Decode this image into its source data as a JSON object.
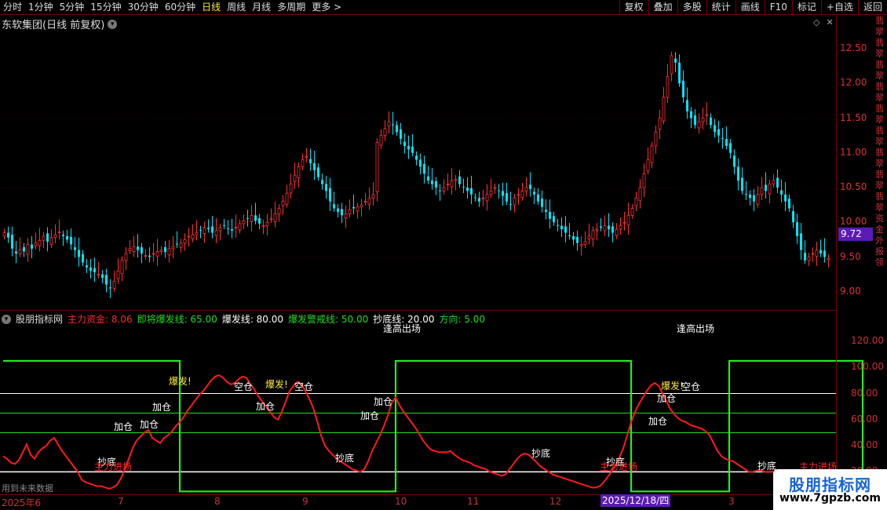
{
  "toolbar": {
    "periods": [
      "分时",
      "1分钟",
      "5分钟",
      "15分钟",
      "30分钟",
      "60分钟",
      "日线",
      "周线",
      "月线",
      "多周期",
      "更多"
    ],
    "active_period": "日线",
    "more_arrow": ">",
    "tools": [
      "复权",
      "叠加",
      "多股",
      "统计",
      "画线",
      "F10",
      "标记",
      "+自选",
      "返回"
    ]
  },
  "main_chart": {
    "title": "东软集团(日线 前复权)",
    "current_price": "9.72",
    "price_axis": [
      "12.50",
      "12.00",
      "11.50",
      "11.00",
      "10.50",
      "10.00",
      "9.50",
      "9.00"
    ],
    "side_text": "翡翠翡翠翡翠翡翠翡翠翡翠翡翠翡翠翡翠资金外报领"
  },
  "indicator": {
    "name": "股朋指标网",
    "params": [
      {
        "label": "主力资金:",
        "value": "8.06",
        "color": "#ff2a2a"
      },
      {
        "label": "即将爆发线:",
        "value": "65.00",
        "color": "#22dd22"
      },
      {
        "label": "爆发线:",
        "value": "80.00",
        "color": "#ffffff"
      },
      {
        "label": "爆发警戒线:",
        "value": "50.00",
        "color": "#22dd22"
      },
      {
        "label": "抄底线:",
        "value": "20.00",
        "color": "#ffffff"
      },
      {
        "label": "方向:",
        "value": "5.00",
        "color": "#22dd22"
      }
    ],
    "axis": [
      "120.00",
      "100.00",
      "80.00",
      "60.00",
      "40.00",
      "20.00"
    ],
    "signals": {
      "chaodi": "抄底",
      "jiacang": "加仓",
      "kongcang": "空仓",
      "baofa": "爆发!",
      "zhulijinchang": "主力进场",
      "tiaogao": "逢高出场"
    },
    "future_note": "用到未来数据",
    "side_text": "翡翠翡翠翡翠翡翠"
  },
  "date_axis": {
    "labels": [
      "2025年6",
      "7",
      "8",
      "9",
      "10",
      "11",
      "12",
      "2",
      "3"
    ],
    "cursor_date": "2025/12/18/四"
  },
  "watermark": {
    "title": "股朋指标网",
    "url": "www.7gpzb.com"
  },
  "colors": {
    "up": "#ff3232",
    "down": "#00e5ff",
    "main_line": "#ff1a1a",
    "direction_line": "#22ee22",
    "frame": "#7a0000",
    "label_red": "#d33333",
    "cursor": "#5b1bb5"
  },
  "chart_data": [
    {
      "type": "candlestick",
      "title": "东软集团(日线 前复权)",
      "ylim": [
        8.85,
        12.75
      ],
      "close": [
        9.85,
        9.78,
        9.62,
        9.55,
        9.6,
        9.58,
        9.68,
        9.62,
        9.7,
        9.74,
        9.8,
        9.72,
        9.78,
        9.82,
        9.86,
        9.8,
        9.75,
        9.68,
        9.6,
        9.5,
        9.42,
        9.35,
        9.3,
        9.28,
        9.25,
        9.2,
        9.1,
        9.05,
        9.15,
        9.3,
        9.45,
        9.55,
        9.62,
        9.65,
        9.6,
        9.55,
        9.52,
        9.5,
        9.55,
        9.58,
        9.6,
        9.57,
        9.62,
        9.65,
        9.68,
        9.7,
        9.75,
        9.8,
        9.82,
        9.85,
        9.88,
        9.92,
        9.9,
        9.85,
        9.88,
        9.92,
        9.95,
        9.9,
        9.88,
        9.93,
        9.98,
        10.02,
        10.05,
        10.1,
        10.02,
        9.98,
        9.95,
        10.0,
        10.05,
        10.12,
        10.2,
        10.3,
        10.42,
        10.55,
        10.68,
        10.8,
        10.9,
        10.95,
        10.85,
        10.75,
        10.65,
        10.55,
        10.45,
        10.3,
        10.2,
        10.15,
        10.1,
        10.12,
        10.18,
        10.2,
        10.22,
        10.25,
        10.3,
        10.35,
        10.4,
        11.15,
        11.25,
        11.35,
        11.45,
        11.4,
        11.3,
        11.2,
        11.1,
        11.05,
        11.0,
        10.9,
        10.8,
        10.7,
        10.6,
        10.55,
        10.5,
        10.45,
        10.5,
        10.55,
        10.6,
        10.62,
        10.55,
        10.5,
        10.45,
        10.4,
        10.35,
        10.3,
        10.35,
        10.4,
        10.45,
        10.5,
        10.45,
        10.38,
        10.3,
        10.25,
        10.35,
        10.4,
        10.45,
        10.5,
        10.48,
        10.4,
        10.3,
        10.22,
        10.15,
        10.05,
        10.0,
        9.95,
        9.9,
        9.85,
        9.8,
        9.75,
        9.7,
        9.68,
        9.72,
        9.8,
        9.88,
        9.9,
        9.92,
        9.95,
        9.9,
        9.85,
        9.9,
        9.95,
        10.0,
        10.1,
        10.2,
        10.35,
        10.5,
        10.7,
        10.9,
        11.1,
        11.3,
        11.5,
        11.8,
        12.1,
        12.4,
        12.3,
        12.0,
        11.8,
        11.6,
        11.5,
        11.4,
        11.45,
        11.5,
        11.55,
        11.4,
        11.3,
        11.25,
        11.2,
        11.1,
        11.0,
        10.8,
        10.6,
        10.45,
        10.4,
        10.35,
        10.3,
        10.4,
        10.5,
        10.45,
        10.55,
        10.6,
        10.5,
        10.4,
        10.3,
        10.2,
        10.0,
        9.8,
        9.6,
        9.45,
        9.5,
        9.55,
        9.6,
        9.55,
        9.5,
        9.48
      ]
    },
    {
      "type": "line",
      "title": "股朋指标网",
      "ylim": [
        4,
        135
      ],
      "reference_lines": [
        {
          "name": "爆发线",
          "value": 80
        },
        {
          "name": "即将爆发线",
          "value": 65
        },
        {
          "name": "爆发警戒线",
          "value": 50
        },
        {
          "name": "抄底线",
          "value": 20
        }
      ],
      "series": [
        {
          "name": "主力资金",
          "values": [
            32,
            30,
            27,
            26,
            29,
            35,
            41,
            33,
            30,
            35,
            38,
            40,
            44,
            46,
            41,
            36,
            32,
            28,
            24,
            20,
            14,
            12,
            11,
            10,
            9,
            9,
            8,
            7,
            8,
            10,
            15,
            22,
            30,
            38,
            44,
            47,
            50,
            52,
            46,
            44,
            42,
            46,
            48,
            51,
            55,
            58,
            62,
            67,
            71,
            75,
            79,
            82,
            86,
            90,
            93,
            94,
            92,
            89,
            87,
            88,
            91,
            93,
            92,
            87,
            83,
            78,
            74,
            70,
            66,
            62,
            60,
            66,
            74,
            82,
            86,
            89,
            87,
            82,
            76,
            69,
            59,
            48,
            40,
            36,
            33,
            30,
            28,
            26,
            24,
            22,
            21,
            20,
            22,
            28,
            36,
            42,
            48,
            55,
            63,
            73,
            77,
            71,
            66,
            62,
            58,
            54,
            49,
            44,
            40,
            37,
            36,
            35,
            35,
            35,
            36,
            33,
            31,
            29,
            28,
            27,
            25,
            24,
            23,
            22,
            20,
            19,
            18,
            17,
            18,
            22,
            26,
            30,
            33,
            34,
            33,
            30,
            27,
            24,
            22,
            20,
            18,
            17,
            16,
            15,
            14,
            13,
            12,
            11,
            10,
            9,
            8,
            8,
            9,
            12,
            16,
            20,
            25,
            31,
            38,
            48,
            58,
            66,
            72,
            77,
            82,
            86,
            88,
            86,
            80,
            74,
            68,
            64,
            61,
            59,
            58,
            56,
            55,
            54,
            53,
            51,
            48,
            42,
            36,
            32,
            30,
            29,
            28,
            26,
            24,
            22,
            20,
            20,
            21,
            21,
            20,
            20,
            20,
            21,
            20,
            20,
            19,
            18,
            20
          ]
        },
        {
          "name": "方向",
          "values": [
            105,
            105,
            105,
            105,
            105,
            105,
            105,
            105,
            105,
            105,
            105,
            105,
            105,
            105,
            105,
            105,
            105,
            105,
            105,
            105,
            105,
            105,
            105,
            105,
            105,
            105,
            105,
            105,
            105,
            105,
            105,
            105,
            105,
            105,
            105,
            105,
            105,
            105,
            105,
            105,
            105,
            105,
            105,
            105,
            105,
            5,
            5,
            5,
            5,
            5,
            5,
            5,
            5,
            5,
            5,
            5,
            5,
            5,
            5,
            5,
            5,
            5,
            5,
            5,
            5,
            5,
            5,
            5,
            5,
            5,
            5,
            5,
            5,
            5,
            5,
            5,
            5,
            5,
            5,
            5,
            5,
            5,
            5,
            5,
            5,
            5,
            5,
            5,
            5,
            5,
            5,
            5,
            5,
            5,
            5,
            5,
            5,
            5,
            5,
            5,
            105,
            105,
            105,
            105,
            105,
            105,
            105,
            105,
            105,
            105,
            105,
            105,
            105,
            105,
            105,
            105,
            105,
            105,
            105,
            105,
            105,
            105,
            105,
            105,
            105,
            105,
            105,
            105,
            105,
            105,
            105,
            105,
            105,
            105,
            105,
            105,
            105,
            105,
            105,
            105,
            105,
            105,
            105,
            105,
            105,
            105,
            105,
            105,
            105,
            105,
            105,
            105,
            105,
            105,
            105,
            105,
            105,
            105,
            105,
            105,
            5,
            5,
            5,
            5,
            5,
            5,
            5,
            5,
            5,
            5,
            5,
            5,
            5,
            5,
            5,
            5,
            5,
            5,
            5,
            5,
            5,
            5,
            5,
            5,
            5,
            105,
            105,
            105,
            105,
            105,
            105,
            105,
            105,
            105,
            105,
            105,
            105,
            105,
            105,
            105,
            105,
            105,
            105,
            105,
            105,
            105,
            105,
            105,
            105,
            105,
            105,
            105,
            105,
            105,
            105,
            105,
            105,
            105,
            105,
            5,
            5,
            5,
            5,
            5,
            5,
            5
          ]
        }
      ]
    }
  ]
}
